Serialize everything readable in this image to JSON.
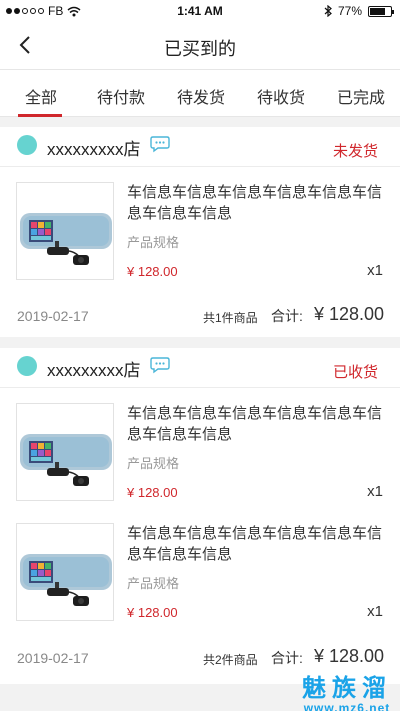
{
  "status_bar": {
    "carrier": "FB",
    "time": "1:41 AM",
    "battery": "77%",
    "battery_level": 0.77
  },
  "nav": {
    "title": "已买到的"
  },
  "tabs": [
    {
      "label": "全部",
      "active": true
    },
    {
      "label": "待付款"
    },
    {
      "label": "待发货"
    },
    {
      "label": "待收货"
    },
    {
      "label": "已完成"
    }
  ],
  "orders": [
    {
      "shop": "xxxxxxxxx店",
      "status": "未发货",
      "items": [
        {
          "title": "车信息车信息车信息车信息车信息车信息车信息车信息",
          "spec": "产品规格",
          "price": "¥ 128.00",
          "qty": "x1"
        }
      ],
      "date": "2019-02-17",
      "count": "共1件商品",
      "total_label": "合计:",
      "total": "¥ 128.00"
    },
    {
      "shop": "xxxxxxxxx店",
      "status": "已收货",
      "items": [
        {
          "title": "车信息车信息车信息车信息车信息车信息车信息车信息",
          "spec": "产品规格",
          "price": "¥ 128.00",
          "qty": "x1"
        },
        {
          "title": "车信息车信息车信息车信息车信息车信息车信息车信息",
          "spec": "产品规格",
          "price": "¥ 128.00",
          "qty": "x1"
        }
      ],
      "date": "2019-02-17",
      "count": "共2件商品",
      "total_label": "合计:",
      "total": "¥ 128.00"
    }
  ],
  "watermark": {
    "name": "魅族溜",
    "url": "www.mz6.net"
  },
  "colors": {
    "accent": "#d0272c",
    "avatar": "#66d3d0",
    "chat": "#4ab6d8",
    "watermark": "#1aa3e8"
  }
}
